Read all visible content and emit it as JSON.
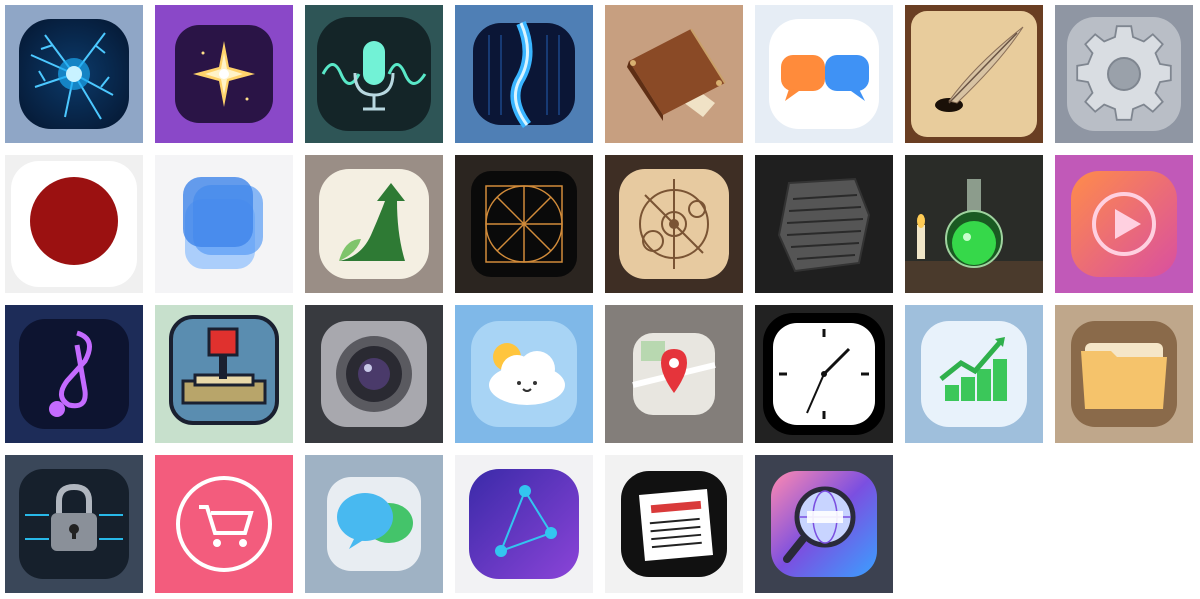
{
  "app_icons": [
    {
      "icon": "neural-energy-icon",
      "colors": {
        "bg": "#8fa6c6",
        "main": "#2fb4f5"
      }
    },
    {
      "icon": "sparkle-star-icon",
      "colors": {
        "bg": "#8a48c8",
        "main": "#ffd36b"
      }
    },
    {
      "icon": "voice-microphone-icon",
      "colors": {
        "bg": "#2e5556",
        "main": "#6ff0d0"
      }
    },
    {
      "icon": "data-stream-icon",
      "colors": {
        "bg": "#4f7fb5",
        "main": "#3ab5ff"
      }
    },
    {
      "icon": "leather-book-icon",
      "colors": {
        "bg": "#c79f80",
        "main": "#8a4a26"
      }
    },
    {
      "icon": "chat-bubbles-icon",
      "colors": {
        "bg": "#e6edf5",
        "main": "#ff8b3b"
      }
    },
    {
      "icon": "quill-pen-icon",
      "colors": {
        "bg": "#6a3e22",
        "main": "#e8cc9c"
      }
    },
    {
      "icon": "settings-gear-icon",
      "colors": {
        "bg": "#8f96a3",
        "main": "#c7ccd3"
      }
    },
    {
      "icon": "record-button-icon",
      "colors": {
        "bg": "#f0f0f0",
        "main": "#9b1111"
      }
    },
    {
      "icon": "layered-squares-icon",
      "colors": {
        "bg": "#f4f4f6",
        "main": "#4a8df0"
      }
    },
    {
      "icon": "growth-arrow-icon",
      "colors": {
        "bg": "#9a8e86",
        "main": "#2e7a34"
      }
    },
    {
      "icon": "grid-circle-icon",
      "colors": {
        "bg": "#2b2520",
        "main": "#d18b3a"
      }
    },
    {
      "icon": "compass-mechanism-icon",
      "colors": {
        "bg": "#3e2e24",
        "main": "#e7caa0"
      }
    },
    {
      "icon": "stone-tablet-icon",
      "colors": {
        "bg": "#1f1f1f",
        "main": "#555555"
      }
    },
    {
      "icon": "potion-flask-icon",
      "colors": {
        "bg": "#2a2c28",
        "main": "#36d84a"
      }
    },
    {
      "icon": "play-button-icon",
      "colors": {
        "bg": "#c159b8",
        "main": "#ff8c4a"
      }
    },
    {
      "icon": "music-note-icon",
      "colors": {
        "bg": "#1d2c58",
        "main": "#c46bff"
      }
    },
    {
      "icon": "pixel-joystick-icon",
      "colors": {
        "bg": "#c7e0cc",
        "main": "#e0312e"
      }
    },
    {
      "icon": "camera-lens-icon",
      "colors": {
        "bg": "#383a3f",
        "main": "#a8a8ae"
      }
    },
    {
      "icon": "weather-cloud-icon",
      "colors": {
        "bg": "#7fb8e8",
        "main": "#ffffff"
      }
    },
    {
      "icon": "map-pin-icon",
      "colors": {
        "bg": "#837e7a",
        "main": "#e5343b"
      }
    },
    {
      "icon": "clock-icon",
      "colors": {
        "bg": "#222222",
        "main": "#ffffff"
      }
    },
    {
      "icon": "stock-chart-icon",
      "colors": {
        "bg": "#9fbfdc",
        "main": "#3bc75a"
      }
    },
    {
      "icon": "folder-icon",
      "colors": {
        "bg": "#bfa78b",
        "main": "#f5c36b"
      }
    },
    {
      "icon": "circuit-lock-icon",
      "colors": {
        "bg": "#3a4759",
        "main": "#28b8e8"
      }
    },
    {
      "icon": "shopping-cart-icon",
      "colors": {
        "bg": "#f35c7d",
        "main": "#ffffff"
      }
    },
    {
      "icon": "message-bubbles-icon",
      "colors": {
        "bg": "#9fb2c4",
        "main": "#48b9f0"
      }
    },
    {
      "icon": "network-triangle-icon",
      "colors": {
        "bg": "#f2f2f4",
        "main": "#33c5f0"
      }
    },
    {
      "icon": "newspaper-icon",
      "colors": {
        "bg": "#f2f2f2",
        "main": "#111111"
      }
    },
    {
      "icon": "web-search-icon",
      "colors": {
        "bg": "#3c4150",
        "main": "#7b4fe0"
      }
    }
  ]
}
